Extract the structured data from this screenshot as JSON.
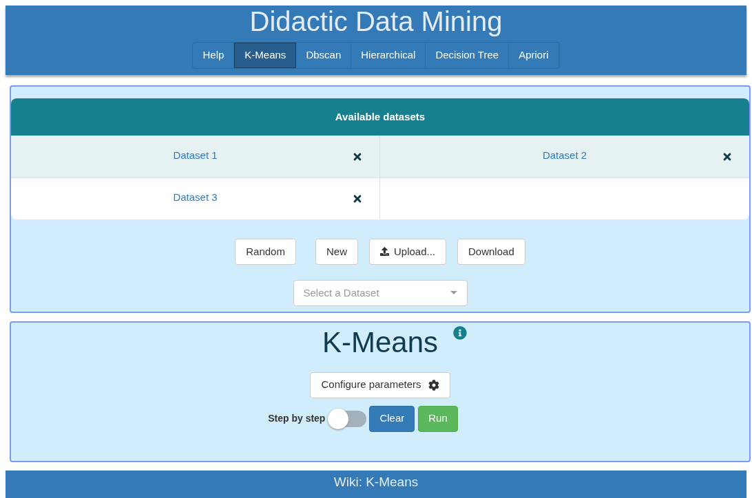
{
  "header": {
    "title": "Didactic Data Mining"
  },
  "tabs": [
    {
      "label": "Help",
      "selected": false
    },
    {
      "label": "K-Means",
      "selected": true
    },
    {
      "label": "Dbscan",
      "selected": false
    },
    {
      "label": "Hierarchical",
      "selected": false
    },
    {
      "label": "Decision Tree",
      "selected": false
    },
    {
      "label": "Apriori",
      "selected": false
    }
  ],
  "datasets": {
    "title": "Available datasets",
    "items": [
      {
        "name": "Dataset 1"
      },
      {
        "name": "Dataset 2"
      },
      {
        "name": "Dataset 3"
      }
    ]
  },
  "dataset_buttons": [
    {
      "label": "Random",
      "kind": "plain"
    },
    {
      "label": "New",
      "kind": "plain"
    },
    {
      "label": "Upload...",
      "kind": "upload"
    },
    {
      "label": "Download",
      "kind": "plain"
    }
  ],
  "dataset_select": {
    "placeholder": "Select a Dataset"
  },
  "algorithm": {
    "title": "K-Means",
    "configure": "Configure parameters",
    "step_label": "Step by step",
    "step_by_step": false,
    "clear": "Clear",
    "run": "Run"
  },
  "footer": {
    "text": "Wiki: K-Means"
  }
}
